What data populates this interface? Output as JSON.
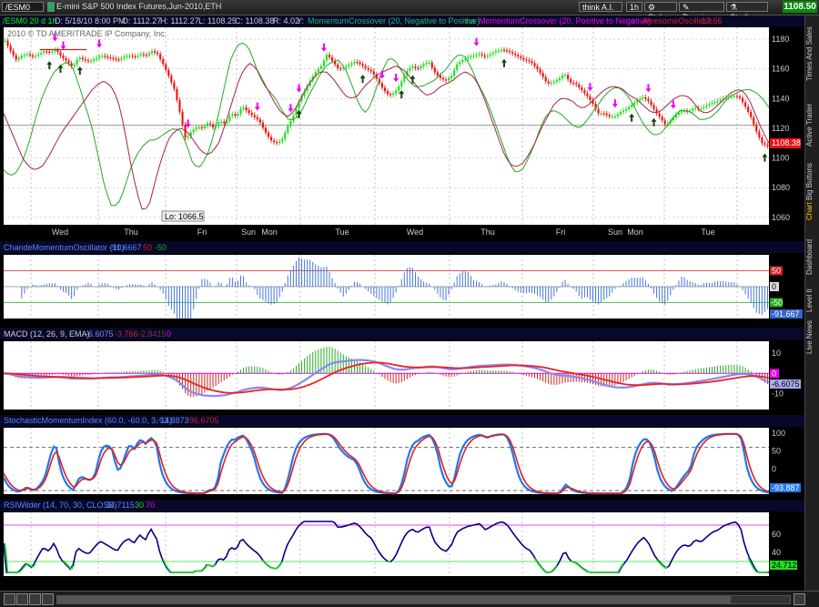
{
  "toolbar": {
    "symbol": "/ESM0",
    "title": "E-mini S&P 500 Index Futures,Jun-2010,ETH",
    "think_ai": "think A.I.",
    "interval": "1h",
    "style": "Style",
    "drawings": "Drawings",
    "studies": "Studies",
    "last_price": "1108.50"
  },
  "sidebar": {
    "tabs": [
      "Times And Sales",
      "Active Trader",
      "Big Buttons",
      "Chart",
      "Dashboard",
      "Level II",
      "Live News"
    ]
  },
  "colors": {
    "up": "#22dd22",
    "down": "#ee1111",
    "bg": "#ffffff",
    "grid": "#bbbbbb",
    "ma_green": "#22aa22",
    "ma_red": "#aa2244",
    "arrow_magenta": "#ee00ee",
    "macd_fast": "#8888ee",
    "macd_slow": "#ee2222",
    "smi_blue": "#2277ee",
    "rsi": "#000088",
    "rsi_low": "#22dd22"
  },
  "chart_data": [
    {
      "type": "candlestick",
      "header": {
        "symbol": "/ESM0 20 d 1h",
        "d": "D: 5/18/10 8:00 PM",
        "o": "O: 1112.27",
        "h": "H: 1112.27",
        "l": "L: 1108.25",
        "c": "C: 1108.38",
        "r": "R: 4.02",
        "y": "Y:",
        "study1": "MomentumCrossover (20, Negative to Positive)",
        "study1b": "na",
        "study2": "MomentumCrossover (20, Positive to Negative)",
        "study2b": "na",
        "study3": "AwesomeOscillator",
        "study3v": "-17.66"
      },
      "copyright": "2010 © TD AMERITRADE IP Company, Inc.",
      "ylim": [
        1055,
        1188
      ],
      "yticks": [
        1060,
        1080,
        1100,
        1120,
        1140,
        1160,
        1180
      ],
      "hline": 1122,
      "current_label": "1108.38",
      "low_label": "Lo: 1066.5",
      "xlabels": [
        "Wed",
        "Thu",
        "Fri",
        "Sun",
        "Mon",
        "Tue",
        "Wed",
        "Thu",
        "Fri",
        "Sun",
        "Mon",
        "Tue"
      ],
      "close": [
        1179,
        1172,
        1166,
        1169,
        1170,
        1168,
        1170,
        1172,
        1171,
        1173,
        1168,
        1165,
        1161,
        1168,
        1166,
        1165,
        1167,
        1169,
        1168,
        1167,
        1166,
        1168,
        1169,
        1168,
        1170,
        1169,
        1172,
        1170,
        1163,
        1155,
        1146,
        1130,
        1112,
        1118,
        1121,
        1120,
        1124,
        1120,
        1125,
        1123,
        1130,
        1128,
        1135,
        1131,
        1128,
        1125,
        1118,
        1112,
        1110,
        1112,
        1121,
        1128,
        1138,
        1145,
        1152,
        1158,
        1162,
        1170,
        1165,
        1160,
        1161,
        1163,
        1165,
        1163,
        1160,
        1158,
        1152,
        1146,
        1142,
        1144,
        1150,
        1158,
        1162,
        1160,
        1163,
        1165,
        1158,
        1154,
        1152,
        1155,
        1163,
        1166,
        1168,
        1169,
        1170,
        1168,
        1170,
        1172,
        1173,
        1172,
        1170,
        1168,
        1166,
        1165,
        1161,
        1156,
        1150,
        1151,
        1153,
        1157,
        1151,
        1150,
        1146,
        1142,
        1137,
        1130,
        1130,
        1128,
        1128,
        1131,
        1133,
        1136,
        1139,
        1141,
        1138,
        1132,
        1127,
        1122,
        1126,
        1130,
        1132,
        1131,
        1134,
        1133,
        1135,
        1137,
        1138,
        1140,
        1141,
        1142,
        1141,
        1135,
        1128,
        1118,
        1110,
        1108
      ],
      "hl_range": [
        4,
        8
      ],
      "ma_green": [
        1092,
        1088,
        1090,
        1098,
        1110,
        1126,
        1140,
        1150,
        1158,
        1162,
        1165,
        1160,
        1148,
        1134,
        1120,
        1100,
        1080,
        1068,
        1068,
        1078,
        1092,
        1102,
        1108,
        1112,
        1112,
        1115,
        1118,
        1120,
        1118,
        1108,
        1095,
        1094,
        1100,
        1112,
        1130,
        1150,
        1168,
        1176,
        1178,
        1172,
        1160,
        1150,
        1145,
        1140,
        1132,
        1126,
        1126,
        1130,
        1140,
        1148,
        1156,
        1162,
        1165,
        1166,
        1160,
        1150,
        1138,
        1130,
        1135,
        1148,
        1160,
        1168,
        1165,
        1158,
        1152,
        1148,
        1148,
        1150,
        1152,
        1156,
        1160,
        1166,
        1170,
        1168,
        1160,
        1150,
        1142,
        1132,
        1120,
        1108,
        1096,
        1090,
        1092,
        1100,
        1110,
        1122,
        1130,
        1132,
        1130,
        1126,
        1122,
        1120,
        1124,
        1130,
        1136,
        1142,
        1146,
        1148,
        1145,
        1140,
        1132,
        1124,
        1118,
        1115,
        1117,
        1122,
        1128,
        1132,
        1132,
        1130,
        1126,
        1126,
        1128,
        1132,
        1138,
        1142,
        1144,
        1146,
        1146,
        1144,
        1140,
        1134
      ],
      "ma_red": [
        1130,
        1120,
        1110,
        1100,
        1094,
        1092,
        1094,
        1100,
        1108,
        1116,
        1122,
        1128,
        1134,
        1140,
        1146,
        1150,
        1152,
        1148,
        1140,
        1122,
        1098,
        1078,
        1064,
        1068,
        1085,
        1100,
        1112,
        1118,
        1120,
        1118,
        1112,
        1106,
        1102,
        1104,
        1110,
        1122,
        1136,
        1150,
        1160,
        1164,
        1160,
        1152,
        1144,
        1136,
        1130,
        1128,
        1132,
        1140,
        1148,
        1154,
        1158,
        1158,
        1154,
        1148,
        1142,
        1140,
        1142,
        1148,
        1152,
        1156,
        1158,
        1160,
        1162,
        1160,
        1156,
        1150,
        1145,
        1142,
        1144,
        1148,
        1150,
        1152,
        1156,
        1158,
        1156,
        1150,
        1140,
        1128,
        1116,
        1104,
        1096,
        1094,
        1096,
        1102,
        1110,
        1120,
        1128,
        1136,
        1140,
        1140,
        1138,
        1134,
        1134,
        1138,
        1142,
        1146,
        1148,
        1148,
        1146,
        1142,
        1140,
        1136,
        1132,
        1130,
        1132,
        1136,
        1140,
        1142,
        1142,
        1138,
        1132,
        1130,
        1132,
        1136,
        1140,
        1144,
        1146,
        1145,
        1138,
        1128,
        1118,
        1110
      ],
      "up_arrows": [
        16,
        20,
        27,
        106,
        129,
        143,
        147,
        180,
        226,
        234,
        274
      ],
      "down_arrows": [
        18,
        21,
        34,
        66,
        91,
        103,
        106,
        115,
        136,
        141,
        170,
        211,
        220,
        232,
        241
      ]
    },
    {
      "type": "histogram",
      "header": "ChandeMomentumOscillator (10)",
      "value": "-91.6667",
      "upper": "50",
      "lower": "-50",
      "value_label": "-91.667",
      "ylim": [
        -100,
        100
      ],
      "levels": [
        50,
        0,
        -50
      ]
    },
    {
      "type": "line",
      "header": "MACD (12, 26, 9, EMA)",
      "value": "-6.6075",
      "avg": "-3.766",
      "diff": "-2.8415",
      "zero": "0",
      "value_label": "-6.6075",
      "yticks": [
        10,
        0,
        -10
      ],
      "ylim": [
        -18,
        16
      ]
    },
    {
      "type": "line",
      "header": "StochasticMomentumIndex (60.0, -60.0, 3, 14)",
      "value": "-93.8873",
      "avg": "-96.6705",
      "value_label": "-93.887",
      "yticks": [
        100,
        50,
        0,
        -50
      ],
      "ylim": [
        -70,
        115
      ],
      "levels": [
        60,
        -60
      ]
    },
    {
      "type": "line",
      "header": "RSIWilder (14, 70, 30, CLOSE)",
      "value": "24.7115",
      "os": "30",
      "ob": "70",
      "value_label": "24.712",
      "yticks": [
        60,
        40
      ],
      "ylim": [
        14,
        84
      ],
      "levels": [
        70,
        30
      ]
    }
  ]
}
